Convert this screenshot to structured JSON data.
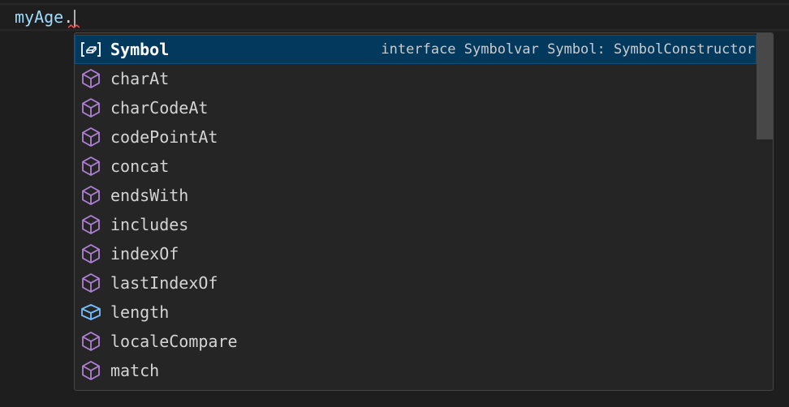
{
  "editor": {
    "code_var": "myAge",
    "code_dot": "."
  },
  "suggestions": {
    "items": [
      {
        "label": "Symbol",
        "detail": "interface Symbolvar Symbol: SymbolConstructor",
        "icon": "variable-icon",
        "selected": true
      },
      {
        "label": "charAt",
        "icon": "method-icon"
      },
      {
        "label": "charCodeAt",
        "icon": "method-icon"
      },
      {
        "label": "codePointAt",
        "icon": "method-icon"
      },
      {
        "label": "concat",
        "icon": "method-icon"
      },
      {
        "label": "endsWith",
        "icon": "method-icon"
      },
      {
        "label": "includes",
        "icon": "method-icon"
      },
      {
        "label": "indexOf",
        "icon": "method-icon"
      },
      {
        "label": "lastIndexOf",
        "icon": "method-icon"
      },
      {
        "label": "length",
        "icon": "field-icon"
      },
      {
        "label": "localeCompare",
        "icon": "method-icon"
      },
      {
        "label": "match",
        "icon": "method-icon"
      }
    ]
  },
  "colors": {
    "method_icon": "#b180d7",
    "field_icon": "#75beff",
    "selection": "#04395e"
  }
}
